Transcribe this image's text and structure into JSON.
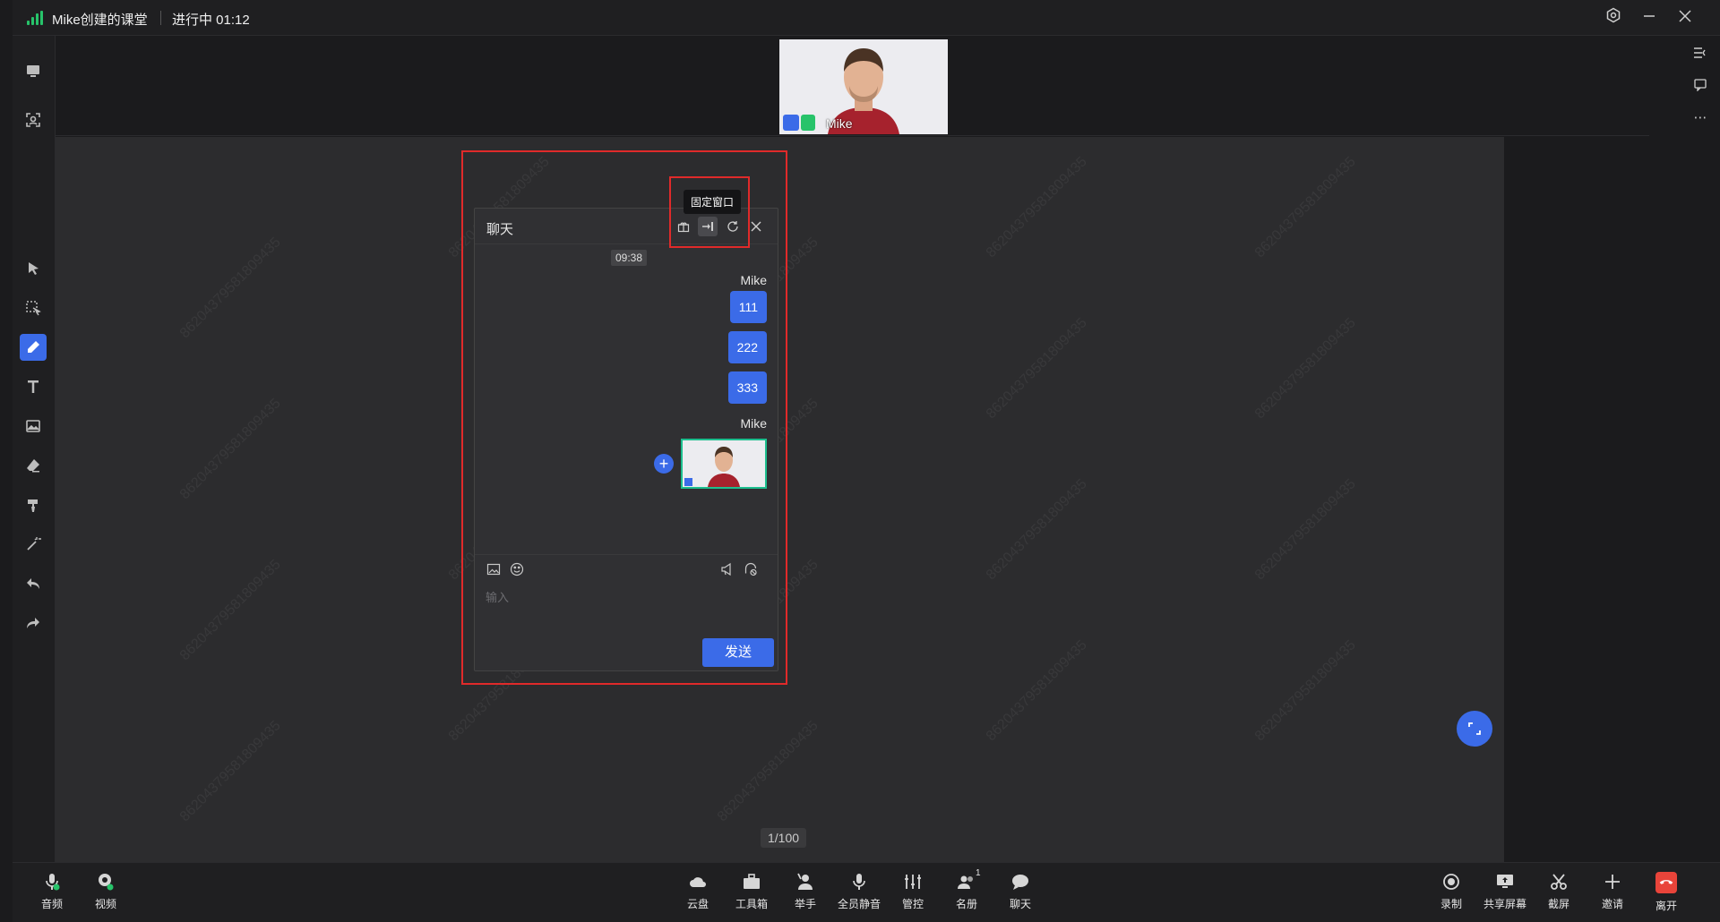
{
  "titlebar": {
    "title": "Mike创建的课堂",
    "status": "进行中 01:12"
  },
  "video": {
    "participant_name": "Mike"
  },
  "board": {
    "watermark": "86204379581809435",
    "page_indicator": "1/100"
  },
  "chat": {
    "title": "聊天",
    "tooltip": "固定窗口",
    "time_chip": "09:38",
    "messages": [
      {
        "sender": "Mike",
        "texts": [
          "111",
          "222",
          "333"
        ]
      },
      {
        "sender": "Mike",
        "image": "video-snapshot"
      }
    ],
    "input_placeholder": "输入",
    "send_label": "发送"
  },
  "bottom_left": [
    {
      "label": "音频",
      "icon": "mic-icon"
    },
    {
      "label": "视频",
      "icon": "camera-icon"
    }
  ],
  "bottom_center": [
    {
      "label": "云盘",
      "icon": "cloud-icon"
    },
    {
      "label": "工具箱",
      "icon": "toolbox-icon"
    },
    {
      "label": "举手",
      "icon": "raise-hand-icon"
    },
    {
      "label": "全员静音",
      "icon": "mute-all-icon"
    },
    {
      "label": "管控",
      "icon": "sliders-icon"
    },
    {
      "label": "名册",
      "icon": "roster-icon"
    },
    {
      "label": "聊天",
      "icon": "chat-icon"
    }
  ],
  "roster_badge": "1",
  "bottom_right": [
    {
      "label": "录制",
      "icon": "record-icon"
    },
    {
      "label": "共享屏幕",
      "icon": "share-screen-icon"
    },
    {
      "label": "截屏",
      "icon": "screenshot-icon"
    },
    {
      "label": "邀请",
      "icon": "plus-icon"
    },
    {
      "label": "离开",
      "icon": "hangup-icon"
    }
  ],
  "colors": {
    "accent": "#3b6be8",
    "highlight": "#e02a2a",
    "leave": "#e9443a",
    "signal": "#27c36a"
  }
}
